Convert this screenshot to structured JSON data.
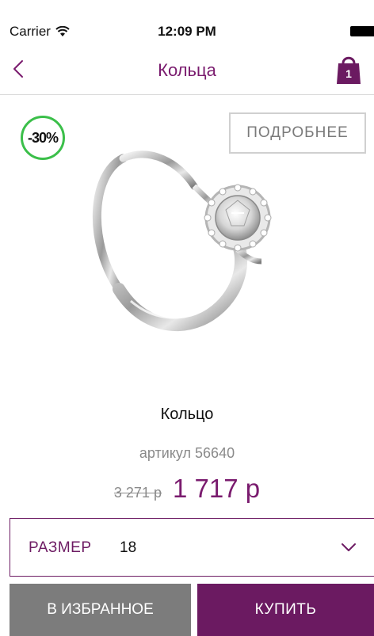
{
  "status_bar": {
    "carrier": "Carrier",
    "time": "12:09 PM"
  },
  "nav": {
    "back_icon": "chevron-left-icon",
    "title": "Кольца",
    "cart_icon": "shopping-bag-icon",
    "cart_count": "1"
  },
  "product": {
    "discount": "-30%",
    "details_label": "ПОДРОБНЕЕ",
    "image_icon": "ring-image",
    "name": "Кольцо",
    "sku_label": "артикул",
    "sku": "56640",
    "old_price": "3 271 р",
    "new_price": "1 717 р"
  },
  "size": {
    "label": "РАЗМЕР",
    "value": "18"
  },
  "actions": {
    "favorite_label": "В ИЗБРАННОЕ",
    "buy_label": "КУПИТЬ"
  },
  "colors": {
    "accent": "#7a1b6e",
    "discount_ring": "#3bbf4a",
    "favorite_bg": "#7c7c7c",
    "buy_bg": "#6b1a61"
  }
}
